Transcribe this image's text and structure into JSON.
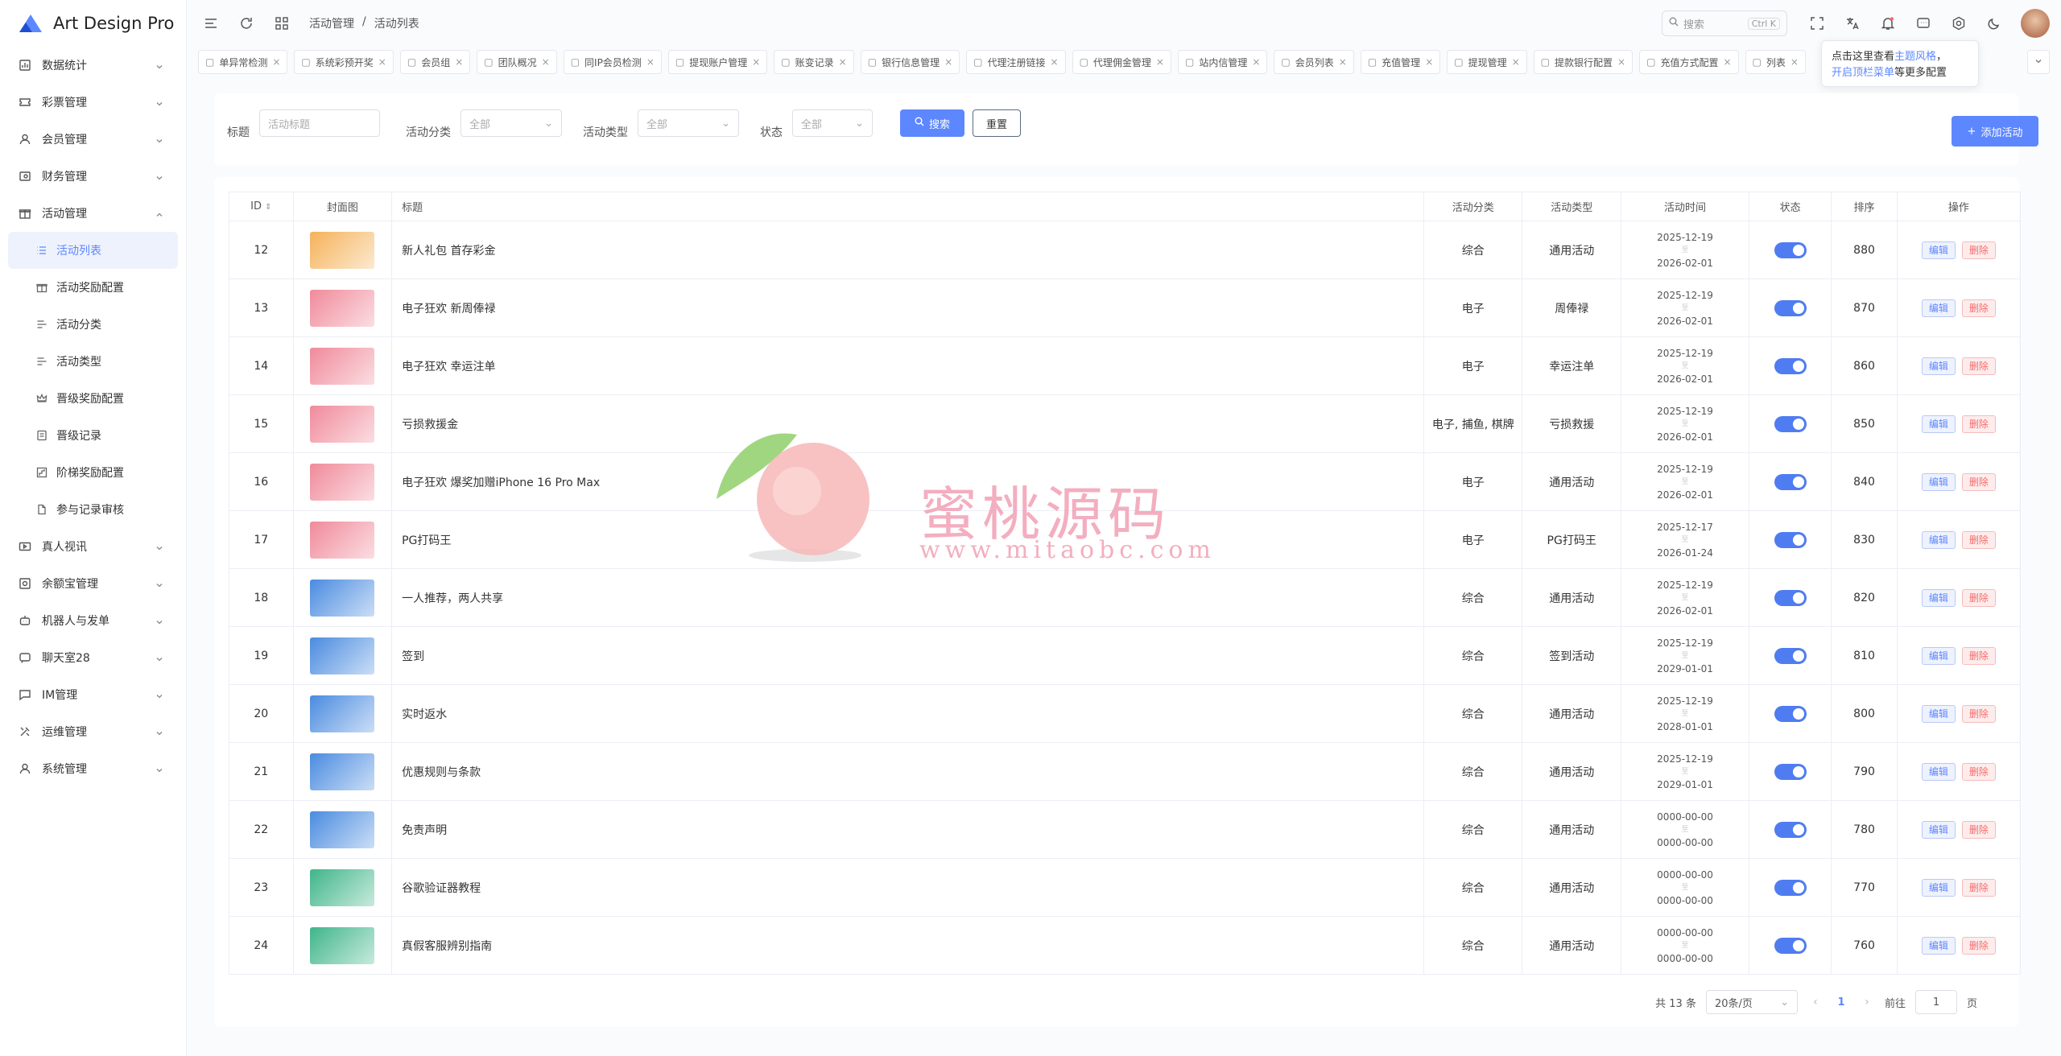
{
  "app": {
    "title": "Art Design Pro"
  },
  "sidebar": {
    "items": [
      {
        "label": "数据统计",
        "icon": "chart-icon"
      },
      {
        "label": "彩票管理",
        "icon": "ticket-icon"
      },
      {
        "label": "会员管理",
        "icon": "user-icon"
      },
      {
        "label": "财务管理",
        "icon": "wallet-icon"
      },
      {
        "label": "活动管理",
        "icon": "gift-icon"
      },
      {
        "label": "真人视讯",
        "icon": "video-icon"
      },
      {
        "label": "余额宝管理",
        "icon": "safe-icon"
      },
      {
        "label": "机器人与发单",
        "icon": "robot-icon"
      },
      {
        "label": "聊天室28",
        "icon": "chat-icon"
      },
      {
        "label": "IM管理",
        "icon": "message-icon"
      },
      {
        "label": "运维管理",
        "icon": "tools-icon"
      },
      {
        "label": "系统管理",
        "icon": "user-icon"
      }
    ],
    "sub_items": [
      {
        "label": "活动列表",
        "icon": "list-icon"
      },
      {
        "label": "活动奖励配置",
        "icon": "gift-icon"
      },
      {
        "label": "活动分类",
        "icon": "list-icon"
      },
      {
        "label": "活动类型",
        "icon": "list-icon"
      },
      {
        "label": "晋级奖励配置",
        "icon": "crown-icon"
      },
      {
        "label": "晋级记录",
        "icon": "document-icon"
      },
      {
        "label": "阶梯奖励配置",
        "icon": "steps-icon"
      },
      {
        "label": "参与记录审核",
        "icon": "file-icon"
      }
    ]
  },
  "breadcrumb": {
    "parent": "活动管理",
    "sep": "/",
    "current": "活动列表"
  },
  "search": {
    "placeholder": "搜索",
    "shortcut": "Ctrl K"
  },
  "tabs": [
    {
      "label": "单异常检测"
    },
    {
      "label": "系统彩预开奖"
    },
    {
      "label": "会员组"
    },
    {
      "label": "团队概况"
    },
    {
      "label": "同IP会员检测"
    },
    {
      "label": "提现账户管理"
    },
    {
      "label": "账变记录"
    },
    {
      "label": "银行信息管理"
    },
    {
      "label": "代理注册链接"
    },
    {
      "label": "代理佣金管理"
    },
    {
      "label": "站内信管理"
    },
    {
      "label": "会员列表"
    },
    {
      "label": "充值管理"
    },
    {
      "label": "提现管理"
    },
    {
      "label": "提款银行配置"
    },
    {
      "label": "充值方式配置"
    },
    {
      "label": "列表"
    }
  ],
  "tooltip": {
    "line1_pre": "点击这里查看",
    "line1_hl": "主题风格",
    "line1_post": "，",
    "line2_hl": "开启顶栏菜单",
    "line2_post": "等更多配置"
  },
  "filter": {
    "title_label": "标题",
    "title_placeholder": "活动标题",
    "category_label": "活动分类",
    "category_value": "全部",
    "type_label": "活动类型",
    "type_value": "全部",
    "status_label": "状态",
    "status_value": "全部",
    "search_btn": "搜索",
    "reset_btn": "重置",
    "add_btn": "添加活动"
  },
  "table": {
    "headers": {
      "id": "ID",
      "cover": "封面图",
      "title": "标题",
      "category": "活动分类",
      "type": "活动类型",
      "time": "活动时间",
      "status": "状态",
      "sort": "排序",
      "op": "操作"
    },
    "edit_label": "编辑",
    "delete_label": "删除",
    "time_sep": "至",
    "rows": [
      {
        "id": "12",
        "title": "新人礼包 首存彩金",
        "category": "综合",
        "type": "通用活动",
        "start": "2025-12-19",
        "end": "2026-02-01",
        "sort": "880",
        "cover": "#f5b25a"
      },
      {
        "id": "13",
        "title": "电子狂欢 新周俸禄",
        "category": "电子",
        "type": "周俸禄",
        "start": "2025-12-19",
        "end": "2026-02-01",
        "sort": "870",
        "cover": "#f08a9a"
      },
      {
        "id": "14",
        "title": "电子狂欢 幸运注单",
        "category": "电子",
        "type": "幸运注单",
        "start": "2025-12-19",
        "end": "2026-02-01",
        "sort": "860",
        "cover": "#f08a9a"
      },
      {
        "id": "15",
        "title": "亏损救援金",
        "category": "电子, 捕鱼, 棋牌",
        "type": "亏损救援",
        "start": "2025-12-19",
        "end": "2026-02-01",
        "sort": "850",
        "cover": "#f08a9a"
      },
      {
        "id": "16",
        "title": "电子狂欢 爆奖加赠iPhone 16 Pro Max",
        "category": "电子",
        "type": "通用活动",
        "start": "2025-12-19",
        "end": "2026-02-01",
        "sort": "840",
        "cover": "#f08a9a"
      },
      {
        "id": "17",
        "title": "PG打码王",
        "category": "电子",
        "type": "PG打码王",
        "start": "2025-12-17",
        "end": "2026-01-24",
        "sort": "830",
        "cover": "#f08a9a"
      },
      {
        "id": "18",
        "title": "一人推荐，两人共享",
        "category": "综合",
        "type": "通用活动",
        "start": "2025-12-19",
        "end": "2026-02-01",
        "sort": "820",
        "cover": "#4a8be0"
      },
      {
        "id": "19",
        "title": "签到",
        "category": "综合",
        "type": "签到活动",
        "start": "2025-12-19",
        "end": "2029-01-01",
        "sort": "810",
        "cover": "#4a8be0"
      },
      {
        "id": "20",
        "title": "实时返水",
        "category": "综合",
        "type": "通用活动",
        "start": "2025-12-19",
        "end": "2028-01-01",
        "sort": "800",
        "cover": "#4a8be0"
      },
      {
        "id": "21",
        "title": "优惠规则与条款",
        "category": "综合",
        "type": "通用活动",
        "start": "2025-12-19",
        "end": "2029-01-01",
        "sort": "790",
        "cover": "#4a8be0"
      },
      {
        "id": "22",
        "title": "免责声明",
        "category": "综合",
        "type": "通用活动",
        "start": "0000-00-00",
        "end": "0000-00-00",
        "sort": "780",
        "cover": "#4a8be0"
      },
      {
        "id": "23",
        "title": "谷歌验证器教程",
        "category": "综合",
        "type": "通用活动",
        "start": "0000-00-00",
        "end": "0000-00-00",
        "sort": "770",
        "cover": "#3fb58a"
      },
      {
        "id": "24",
        "title": "真假客服辨别指南",
        "category": "综合",
        "type": "通用活动",
        "start": "0000-00-00",
        "end": "0000-00-00",
        "sort": "760",
        "cover": "#3fb58a"
      }
    ]
  },
  "pagination": {
    "total": "共 13 条",
    "page_size": "20条/页",
    "current": "1",
    "goto_label": "前往",
    "goto_value": "1",
    "page_unit": "页"
  },
  "watermark": {
    "text": "蜜桃源码",
    "url": "www.mitaobc.com"
  }
}
